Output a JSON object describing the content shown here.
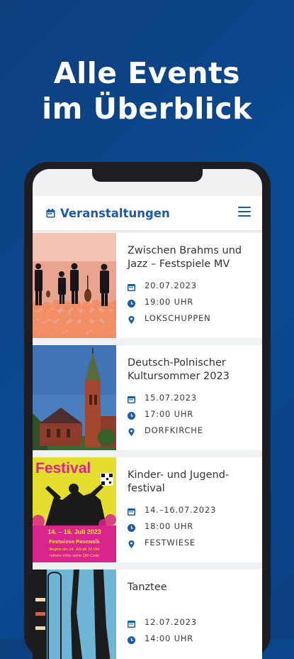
{
  "hero": {
    "line1": "Alle Events",
    "line2": "im Überblick"
  },
  "app": {
    "title": "Veranstaltungen",
    "accent": "#1a5ca8",
    "title_icon": "calendar-icon",
    "menu_icon": "hamburger-menu-icon"
  },
  "events": [
    {
      "title_l1": "Zwischen Brahms und",
      "title_l2": "Jazz – Festspiele MV",
      "date": "20.07.2023",
      "time": "19:00 UHR",
      "place": "LOKSCHUPPEN"
    },
    {
      "title_l1": "Deutsch-Polnischer",
      "title_l2": "Kultursommer 2023",
      "date": "15.07.2023",
      "time": "17:00 UHR",
      "place": "DORFKIRCHE"
    },
    {
      "title_l1": "Kinder- und Jugend-",
      "title_l2": "festival",
      "date": "14.–16.07.2023",
      "time": "18:00 UHR",
      "place": "FESTWIESE"
    },
    {
      "title_l1": "Tanztee",
      "title_l2": "",
      "date": "12.07.2023",
      "time": "14:00 UHR",
      "place": ""
    }
  ],
  "poster": {
    "headline": "Festival",
    "dates": "14. – 16. Juli 2023",
    "venue": "Festwiese Pasewalk",
    "note1": "Beginn am 14. Juli ab 18 Uhr",
    "note2": "nähere Infos siehe QR-Code"
  }
}
